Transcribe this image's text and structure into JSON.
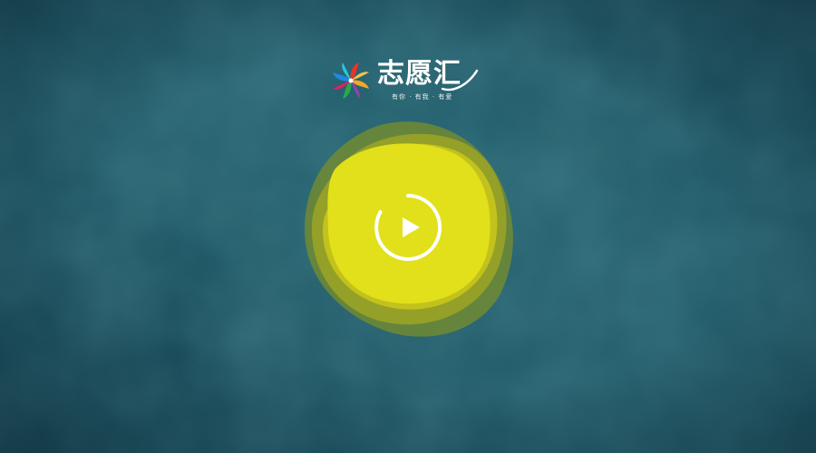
{
  "logo": {
    "title": "志愿汇",
    "tagline": "有你 · 有我 · 有爱"
  },
  "player": {
    "play_icon": "play-icon",
    "state": "paused"
  },
  "colors": {
    "background": "#1f5a69",
    "blob_core": "#e2e01a",
    "blob_outer": "#9aa025",
    "blob_dark": "#6f8a2a",
    "play_icon": "#ffffff"
  }
}
